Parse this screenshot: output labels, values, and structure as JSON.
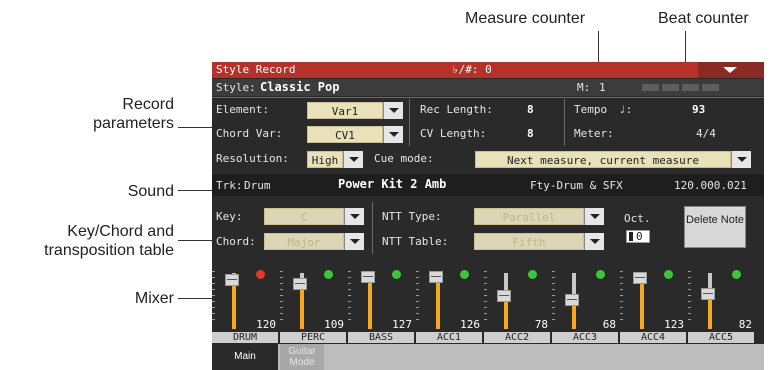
{
  "annotations": {
    "measure_counter": "Measure counter",
    "beat_counter": "Beat counter",
    "record_parameters": "Record parameters",
    "sound": "Sound",
    "key_chord": "Key/Chord and transposition table",
    "mixer": "Mixer"
  },
  "header": {
    "title": "Style Record",
    "key_sig": "♭/#: 0"
  },
  "style": {
    "label": "Style:",
    "name": "Classic Pop",
    "measure_label": "M:",
    "measure": "1"
  },
  "record": {
    "element_label": "Element:",
    "element_value": "Var1",
    "chordvar_label": "Chord Var:",
    "chordvar_value": "CV1",
    "reclength_label": "Rec Length:",
    "reclength_value": "8",
    "cvlength_label": "CV Length:",
    "cvlength_value": "8",
    "tempo_label": "Tempo",
    "tempo_note": "♩:",
    "tempo_value": "93",
    "meter_label": "Meter:",
    "meter_value": "4/4",
    "resolution_label": "Resolution:",
    "resolution_value": "High",
    "cuemode_label": "Cue mode:",
    "cuemode_value": "Next measure, current measure"
  },
  "track": {
    "label": "Trk:",
    "name": "Drum",
    "sound": "Power Kit 2 Amb",
    "category": "Fty-Drum & SFX",
    "program": "120.000.021"
  },
  "keychord": {
    "key_label": "Key:",
    "key_value": "C",
    "chord_label": "Chord:",
    "chord_value": "Major",
    "ntt_type_label": "NTT Type:",
    "ntt_type_value": "Parallel",
    "ntt_table_label": "NTT Table:",
    "ntt_table_value": "Fifth",
    "oct_label": "Oct.",
    "oct_value": "0",
    "delete_label": "Delete Note"
  },
  "mixer": [
    {
      "name": "DRUM",
      "value": "120",
      "level": 0.94,
      "led": "#e23b2e"
    },
    {
      "name": "PERC",
      "value": "109",
      "level": 0.86,
      "led": "#3ec43e"
    },
    {
      "name": "BASS",
      "value": "127",
      "level": 1.0,
      "led": "#3ec43e"
    },
    {
      "name": "ACC1",
      "value": "126",
      "level": 0.99,
      "led": "#3ec43e"
    },
    {
      "name": "ACC2",
      "value": "78",
      "level": 0.61,
      "led": "#3ec43e"
    },
    {
      "name": "ACC3",
      "value": "68",
      "level": 0.54,
      "led": "#3ec43e"
    },
    {
      "name": "ACC4",
      "value": "123",
      "level": 0.97,
      "led": "#3ec43e"
    },
    {
      "name": "ACC5",
      "value": "82",
      "level": 0.65,
      "led": "#3ec43e"
    }
  ],
  "tabs": [
    {
      "label": "Main"
    },
    {
      "label": "Guitar Mode"
    }
  ],
  "colors": {
    "titlebar": "#b5322a",
    "field": "#e9e1ba",
    "fader_fill": "#f5a623"
  }
}
